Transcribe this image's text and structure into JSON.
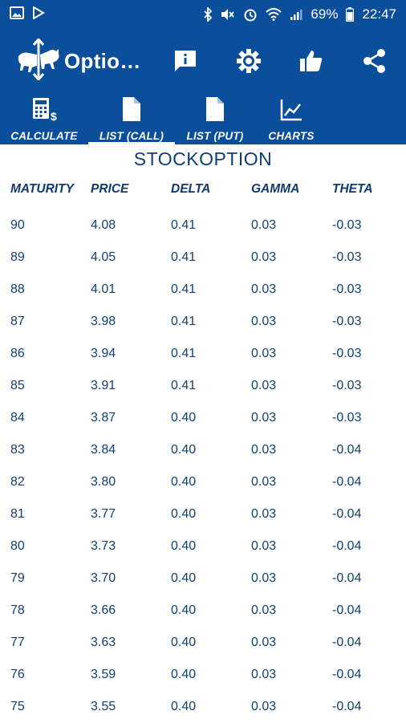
{
  "status_bar": {
    "battery_percent": "69%",
    "time": "22:47",
    "left_icons": [
      "image-icon",
      "play-store-icon"
    ],
    "right_icons": [
      "bluetooth-icon",
      "mute-icon",
      "alarm-icon",
      "wifi-icon",
      "signal-icon",
      "battery-icon"
    ]
  },
  "app_bar": {
    "title": "Optio…",
    "logo_icon": "bull-bear-logo-icon",
    "actions": [
      "info-icon",
      "settings-icon",
      "thumbs-up-icon",
      "share-icon"
    ]
  },
  "tabs": [
    {
      "label": "CALCULATE",
      "icon": "calculator-icon",
      "selected": false
    },
    {
      "label": "LIST (CALL)",
      "icon": "document-icon",
      "selected": true
    },
    {
      "label": "LIST (PUT)",
      "icon": "document-icon",
      "selected": false
    },
    {
      "label": "CHARTS",
      "icon": "chart-icon",
      "selected": false
    }
  ],
  "table": {
    "title": "STOCKOPTION",
    "headers": [
      "MATURITY",
      "PRICE",
      "DELTA",
      "GAMMA",
      "THETA"
    ],
    "rows": [
      [
        "90",
        "4.08",
        "0.41",
        "0.03",
        "-0.03"
      ],
      [
        "89",
        "4.05",
        "0.41",
        "0.03",
        "-0.03"
      ],
      [
        "88",
        "4.01",
        "0.41",
        "0.03",
        "-0.03"
      ],
      [
        "87",
        "3.98",
        "0.41",
        "0.03",
        "-0.03"
      ],
      [
        "86",
        "3.94",
        "0.41",
        "0.03",
        "-0.03"
      ],
      [
        "85",
        "3.91",
        "0.41",
        "0.03",
        "-0.03"
      ],
      [
        "84",
        "3.87",
        "0.40",
        "0.03",
        "-0.03"
      ],
      [
        "83",
        "3.84",
        "0.40",
        "0.03",
        "-0.04"
      ],
      [
        "82",
        "3.80",
        "0.40",
        "0.03",
        "-0.04"
      ],
      [
        "81",
        "3.77",
        "0.40",
        "0.03",
        "-0.04"
      ],
      [
        "80",
        "3.73",
        "0.40",
        "0.03",
        "-0.04"
      ],
      [
        "79",
        "3.70",
        "0.40",
        "0.03",
        "-0.04"
      ],
      [
        "78",
        "3.66",
        "0.40",
        "0.03",
        "-0.04"
      ],
      [
        "77",
        "3.63",
        "0.40",
        "0.03",
        "-0.04"
      ],
      [
        "76",
        "3.59",
        "0.40",
        "0.03",
        "-0.04"
      ],
      [
        "75",
        "3.55",
        "0.40",
        "0.03",
        "-0.04"
      ]
    ]
  },
  "colors": {
    "primary": "#0b4f9c",
    "text": "#0f3f75"
  }
}
